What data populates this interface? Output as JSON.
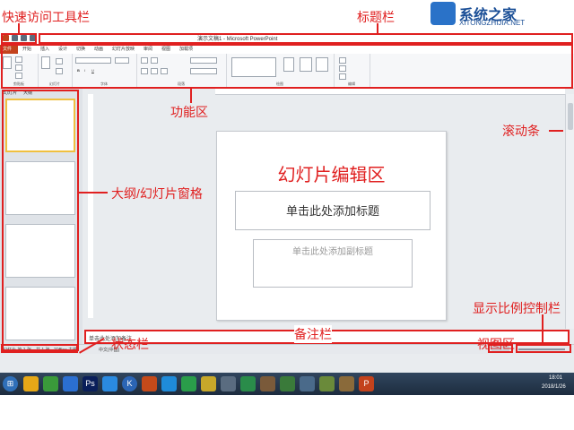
{
  "watermark": {
    "name": "系统之家",
    "url": "XITONGZHIJIA.NET"
  },
  "window": {
    "title": "演示文稿1 - Microsoft PowerPoint",
    "tabs": [
      "文件",
      "开始",
      "插入",
      "设计",
      "切换",
      "动画",
      "幻灯片放映",
      "审阅",
      "视图",
      "加载项"
    ],
    "ribbon_groups": [
      "剪贴板",
      "幻灯片",
      "字体",
      "段落",
      "绘图",
      "编辑"
    ]
  },
  "left_pane": {
    "tabs": [
      "幻灯片",
      "大纲"
    ]
  },
  "slide": {
    "title_text": "幻灯片编辑区",
    "title_placeholder": "单击此处添加标题",
    "subtitle_placeholder": "单击此处添加副标题"
  },
  "notes": {
    "placeholder": "单击此处添加备注"
  },
  "status": {
    "slide_info": "幻灯片 第 1 张，共 1 张",
    "theme": "\"Office 主题\"",
    "language": "中文(中国)"
  },
  "taskbar": {
    "time": "18:01",
    "date": "2018/1/26"
  },
  "annotations": {
    "quick_access": "快速访问工具栏",
    "title_bar": "标题栏",
    "ribbon": "功能区",
    "scrollbar": "滚动条",
    "outline_pane": "大纲/幻灯片窗格",
    "status_bar": "状态栏",
    "notes_bar": "备注栏",
    "view_area": "视图区",
    "zoom_control": "显示比例控制栏"
  },
  "colors": {
    "accent": "#e02020",
    "ppt": "#c3421c",
    "taskbar": "#1d2c3f"
  }
}
